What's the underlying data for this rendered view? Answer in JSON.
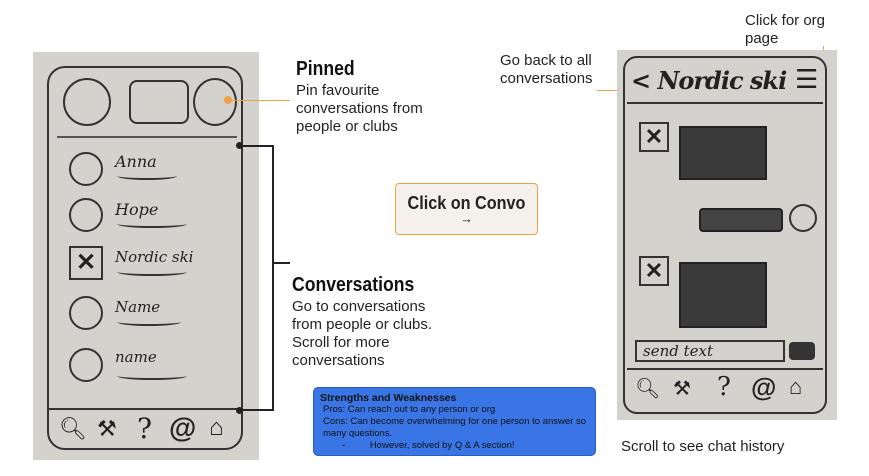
{
  "pinned": {
    "title": "Pinned",
    "description": "Pin favourite conversations from people or clubs"
  },
  "conversations": {
    "title": "Conversations",
    "description": "Go to conversations from people or clubs. Scroll for more conversations"
  },
  "click_convo": {
    "label": "Click on Convo",
    "arrow": "→"
  },
  "strengths": {
    "title": "Strengths and Weaknesses",
    "pros": "Pros: Can reach out to any person or org",
    "cons": "Cons: Can become overwhelming for one person to answer so many questions.",
    "however": "However, solved by Q & A section!",
    "bullet": "-"
  },
  "annotations": {
    "go_back": "Go back to all conversations",
    "org_page": "Click for org page",
    "scroll_history": "Scroll to see chat history"
  },
  "sketch_left": {
    "contacts": [
      "Anna",
      "Hope",
      "Nordic ski",
      "Name",
      "name"
    ]
  },
  "sketch_right": {
    "header": "< Nordic ski",
    "send_text": "send text"
  },
  "colors": {
    "accent_orange": "#f0a04b",
    "box_blue": "#3a75e6",
    "box_bg": "#f4f1ec"
  }
}
